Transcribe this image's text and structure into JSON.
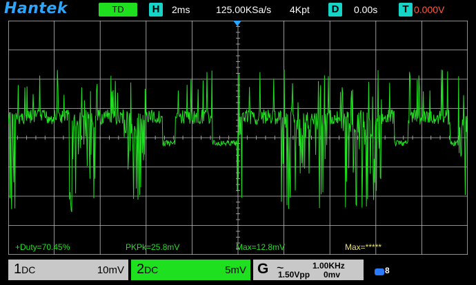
{
  "header": {
    "logo": "Hantek",
    "mode": "TD",
    "h_icon": "H",
    "timebase": "2ms",
    "sample_rate": "125.00KSa/s",
    "memory": "4Kpt",
    "d_icon": "D",
    "delay": "0.00s",
    "t_icon": "T",
    "trigger_level": "0.000V"
  },
  "measurements": {
    "duty": "+Duty=70.45%",
    "pkpk": "PKPk=25.8mV",
    "max": "Max=12.8mV",
    "max2": "Max=*****"
  },
  "channels": {
    "ch1": {
      "name": "1",
      "coupling": "DC",
      "scale": "10mV"
    },
    "ch2": {
      "name": "2",
      "coupling": "DC",
      "scale": "5mV"
    }
  },
  "generator": {
    "letter": "G",
    "wave": "~",
    "frequency": "1.00KHz",
    "amplitude": "1.50Vpp",
    "offset": "0mv",
    "usb_indicator": "8"
  },
  "colors": {
    "trace": "#22e022",
    "grid": "#bfbfbf",
    "logo": "#2aa6ff",
    "cyan_icon": "#16d3c8",
    "measure_green": "#22e022",
    "measure_yellow": "#e8e070"
  },
  "icons": {
    "h": "horizontal-icon",
    "d": "delay-icon",
    "t": "trigger-icon",
    "wave": "sine-wave-icon",
    "usb": "usb-icon"
  }
}
